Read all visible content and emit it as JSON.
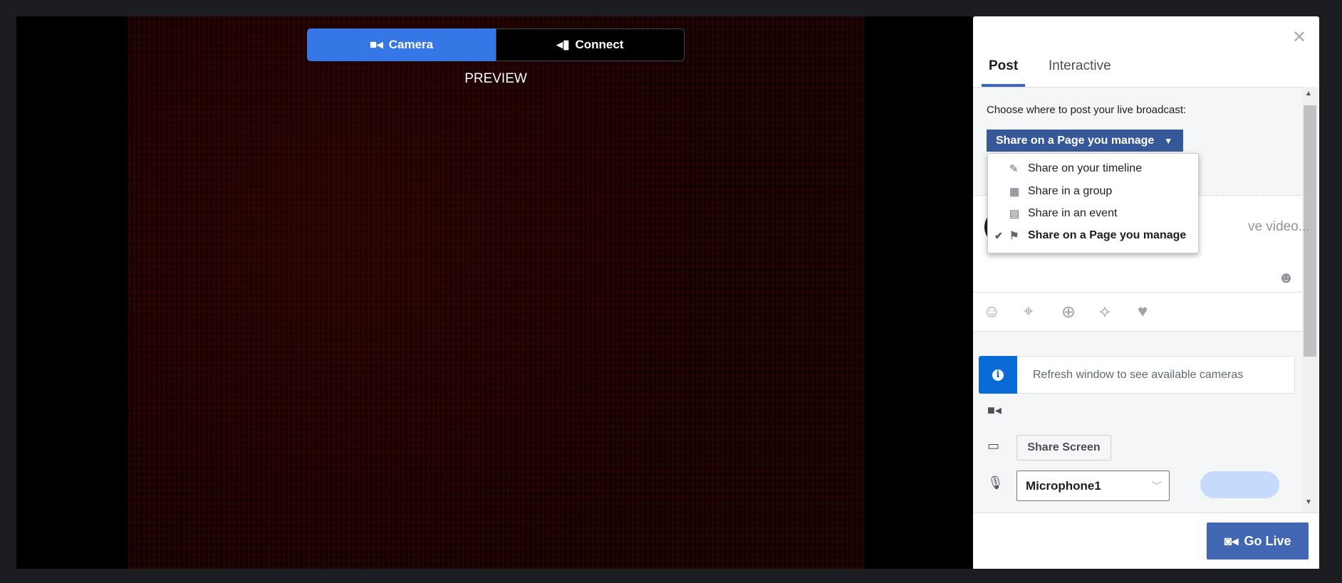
{
  "source_toggle": {
    "camera_label": "Camera",
    "connect_label": "Connect",
    "active": "Camera"
  },
  "preview_label": "PREVIEW",
  "panel": {
    "tabs": [
      {
        "label": "Post",
        "active": true
      },
      {
        "label": "Interactive",
        "active": false
      }
    ],
    "choose_label": "Choose where to post your live broadcast:",
    "destination": {
      "selected": "Share on a Page you manage",
      "options": [
        {
          "label": "Share on your timeline",
          "icon": "edit-icon",
          "checked": false
        },
        {
          "label": "Share in a group",
          "icon": "group-icon",
          "checked": false
        },
        {
          "label": "Share in an event",
          "icon": "calendar-icon",
          "checked": false
        },
        {
          "label": "Share on a Page you manage",
          "icon": "flag-icon",
          "checked": true
        }
      ]
    },
    "composer_placeholder_visible": "ve video...",
    "info_message": "Refresh window to see available cameras",
    "share_screen_label": "Share Screen",
    "microphone": {
      "selected": "Microphone1"
    },
    "go_live_label": "Go Live",
    "colors": {
      "accent": "#4267b2",
      "dropdown": "#365899",
      "info": "#0a6bd7",
      "camera_tab": "#3578e5"
    }
  }
}
